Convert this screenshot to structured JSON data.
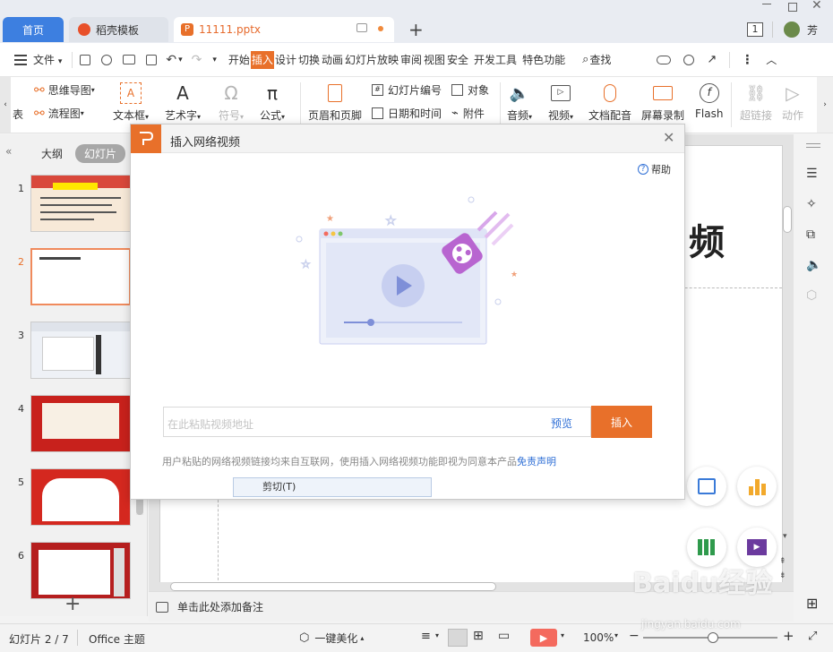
{
  "tabs": {
    "home": "首页",
    "template": "稻壳模板",
    "file": "11111.pptx",
    "add": "+"
  },
  "titlebar": {
    "badge": "1",
    "user": "芳"
  },
  "menu": {
    "file": "文件",
    "items": [
      "开始",
      "插入",
      "设计",
      "切换",
      "动画",
      "幻灯片放映",
      "审阅",
      "视图",
      "安全",
      "开发工具",
      "特色功能"
    ],
    "search": "查找"
  },
  "ribbon": {
    "mindmap": "思维导图",
    "flowchart": "流程图",
    "table_partial": "表",
    "textbox": "文本框",
    "wordart": "艺术字",
    "symbol": "符号",
    "formula": "公式",
    "header_footer": "页眉和页脚",
    "slide_number": "幻灯片编号",
    "date_time": "日期和时间",
    "object": "对象",
    "attachment": "附件",
    "audio": "音频",
    "video": "视频",
    "narration": "文档配音",
    "screen_record": "屏幕录制",
    "flash": "Flash",
    "hyperlink": "超链接",
    "action": "动作"
  },
  "leftpane": {
    "outline": "大纲",
    "slides": "幻灯片",
    "numbers": [
      "1",
      "2",
      "3",
      "4",
      "5",
      "6"
    ],
    "add_button": "+"
  },
  "canvas": {
    "title_partial": "频"
  },
  "notes": {
    "placeholder": "单击此处添加备注"
  },
  "statusbar": {
    "slide_info": "幻灯片 2 / 7",
    "theme": "Office 主题",
    "beautify": "一键美化",
    "zoom": "100%"
  },
  "dialog": {
    "title": "插入网络视频",
    "help": "帮助",
    "input_placeholder": "在此粘贴视频地址",
    "preview": "预览",
    "insert": "插入",
    "disclaimer_text": "用户粘贴的网络视频链接均来自互联网，使用插入网络视频功能即视为同意本产品",
    "disclaimer_link": "免责声明"
  },
  "context_menu": {
    "cut": "剪切(T)"
  },
  "watermark": {
    "brand": "Baidu经验",
    "url": "jingyan.baidu.com"
  },
  "colors": {
    "accent_orange": "#e8702a",
    "home_tab": "#3d7fe0",
    "link_blue": "#2f6fd6",
    "play_red": "#f46a5e"
  }
}
